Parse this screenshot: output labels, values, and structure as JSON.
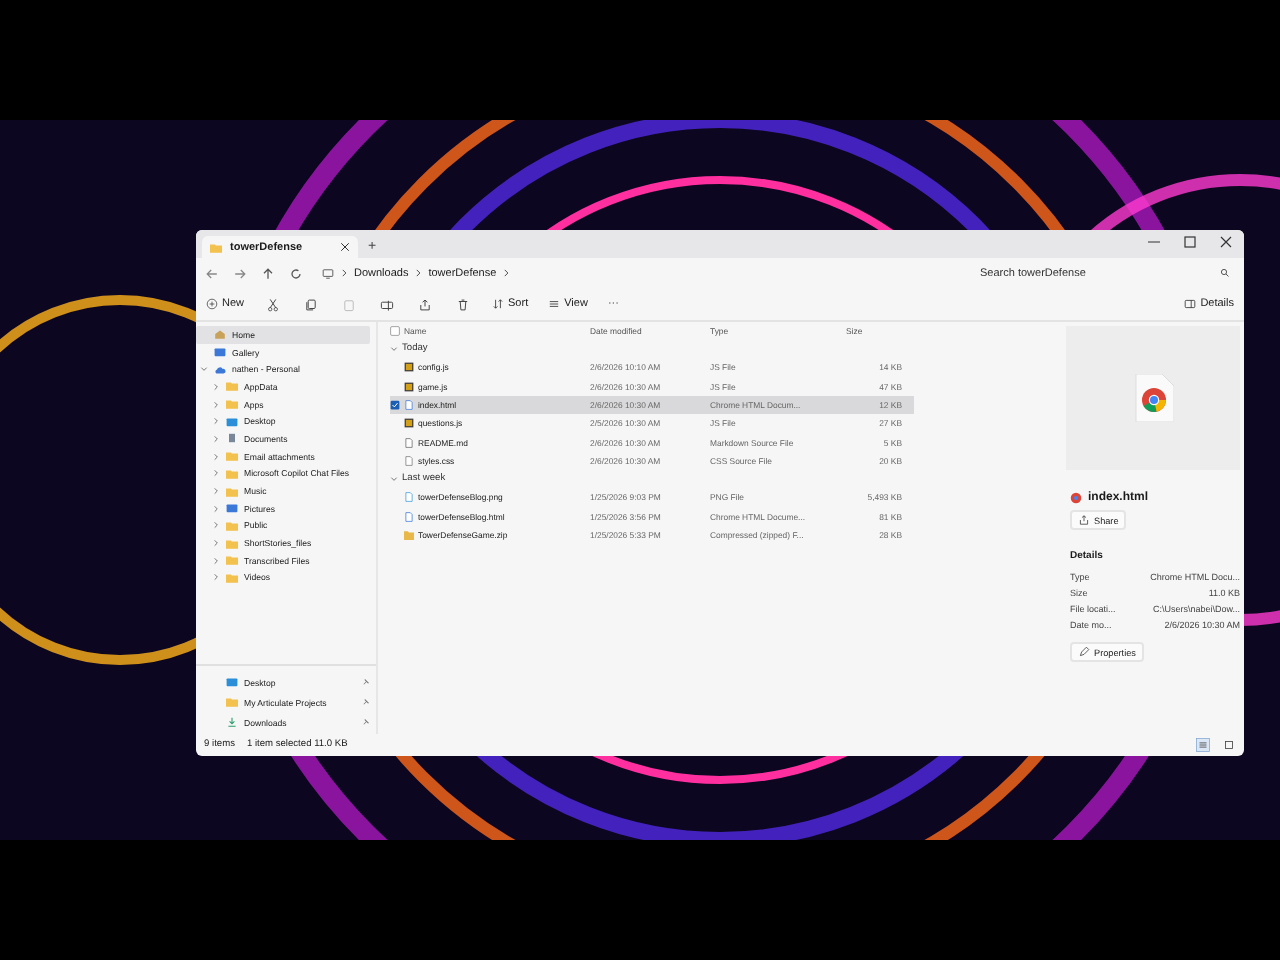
{
  "window": {
    "tab": "towerDefense",
    "new_tab": "+"
  },
  "address": {
    "crumbs": [
      "Downloads",
      "towerDefense"
    ],
    "search_placeholder": "Search towerDefense"
  },
  "toolbar": {
    "new": "New",
    "sort": "Sort",
    "view": "View",
    "more": "···",
    "details": "Details"
  },
  "sidebar": {
    "items": [
      {
        "label": "Home",
        "kind": "home",
        "selected": true
      },
      {
        "label": "Gallery",
        "kind": "gallery",
        "selected": false
      },
      {
        "label": "nathen - Personal",
        "kind": "cloud",
        "selected": false,
        "expanded": true,
        "children": [
          {
            "label": "AppData",
            "kind": "folder",
            "selected": false,
            "expanded": false
          },
          {
            "label": "Apps",
            "kind": "folder",
            "selected": false,
            "expanded": false
          },
          {
            "label": "Desktop",
            "kind": "desktop",
            "selected": false,
            "expanded": false
          },
          {
            "label": "Documents",
            "kind": "documents",
            "selected": false,
            "expanded": false
          },
          {
            "label": "Email attachments",
            "kind": "folder",
            "selected": false,
            "expanded": false
          },
          {
            "label": "Microsoft Copilot Chat Files",
            "kind": "folder",
            "selected": false,
            "expanded": false
          },
          {
            "label": "Music",
            "kind": "folder",
            "selected": false,
            "expanded": false
          },
          {
            "label": "Pictures",
            "kind": "pictures",
            "selected": false,
            "expanded": false
          },
          {
            "label": "Public",
            "kind": "folder",
            "selected": false,
            "expanded": false
          },
          {
            "label": "ShortStories_files",
            "kind": "folder",
            "selected": false,
            "expanded": false
          },
          {
            "label": "Transcribed Files",
            "kind": "folder",
            "selected": false,
            "expanded": false
          },
          {
            "label": "Videos",
            "kind": "folder",
            "selected": false,
            "expanded": false
          }
        ]
      }
    ],
    "quick": [
      {
        "label": "Desktop",
        "kind": "desktop",
        "selected": false,
        "pinned": true
      },
      {
        "label": "My Articulate Projects",
        "kind": "folder",
        "selected": false,
        "pinned": true
      },
      {
        "label": "Downloads",
        "kind": "downloads",
        "selected": false,
        "pinned": true
      }
    ]
  },
  "table": {
    "columns": [
      "Name",
      "Date modified",
      "Type",
      "Size"
    ],
    "all_selected": false,
    "groups": [
      {
        "label": "Today",
        "expanded": true,
        "rows": [
          {
            "name": "config.js",
            "date": "2/6/2026 10:10 AM",
            "type": "JS File",
            "size": "14 KB",
            "kind": "js",
            "selected": false
          },
          {
            "name": "game.js",
            "date": "2/6/2026 10:30 AM",
            "type": "JS File",
            "size": "47 KB",
            "kind": "js",
            "selected": false
          },
          {
            "name": "index.html",
            "date": "2/6/2026 10:30 AM",
            "type": "Chrome HTML Docum...",
            "size": "12 KB",
            "kind": "html",
            "selected": true
          },
          {
            "name": "questions.js",
            "date": "2/5/2026 10:30 AM",
            "type": "JS File",
            "size": "27 KB",
            "kind": "js",
            "selected": false
          },
          {
            "name": "README.md",
            "date": "2/6/2026 10:30 AM",
            "type": "Markdown Source File",
            "size": "5 KB",
            "kind": "md",
            "selected": false
          },
          {
            "name": "styles.css",
            "date": "2/6/2026 10:30 AM",
            "type": "CSS Source File",
            "size": "20 KB",
            "kind": "css",
            "selected": false
          }
        ]
      },
      {
        "label": "Last week",
        "expanded": true,
        "rows": [
          {
            "name": "towerDefenseBlog.png",
            "date": "1/25/2026 9:03 PM",
            "type": "PNG File",
            "size": "5,493 KB",
            "kind": "png",
            "selected": false
          },
          {
            "name": "towerDefenseBlog.html",
            "date": "1/25/2026 3:56 PM",
            "type": "Chrome HTML Docume...",
            "size": "81 KB",
            "kind": "html",
            "selected": false
          },
          {
            "name": "TowerDefenseGame.zip",
            "date": "1/25/2026 5:33 PM",
            "type": "Compressed (zipped) F...",
            "size": "28 KB",
            "kind": "zip",
            "selected": false
          }
        ]
      }
    ]
  },
  "details_pane": {
    "file_name": "index.html",
    "share": "Share",
    "heading": "Details",
    "properties": [
      {
        "label": "Type",
        "value": "Chrome HTML Docu..."
      },
      {
        "label": "Size",
        "value": "11.0 KB"
      },
      {
        "label": "File locati...",
        "value": "C:\\Users\\nabei\\Dow..."
      },
      {
        "label": "Date mo...",
        "value": "2/6/2026 10:30 AM"
      }
    ],
    "properties_button": "Properties"
  },
  "status_bar": {
    "items": "9 items",
    "selection": "1 item selected  11.0 KB"
  },
  "view_buttons": [
    {
      "kind": "details",
      "selected": true
    },
    {
      "kind": "tiles",
      "selected": false
    }
  ]
}
